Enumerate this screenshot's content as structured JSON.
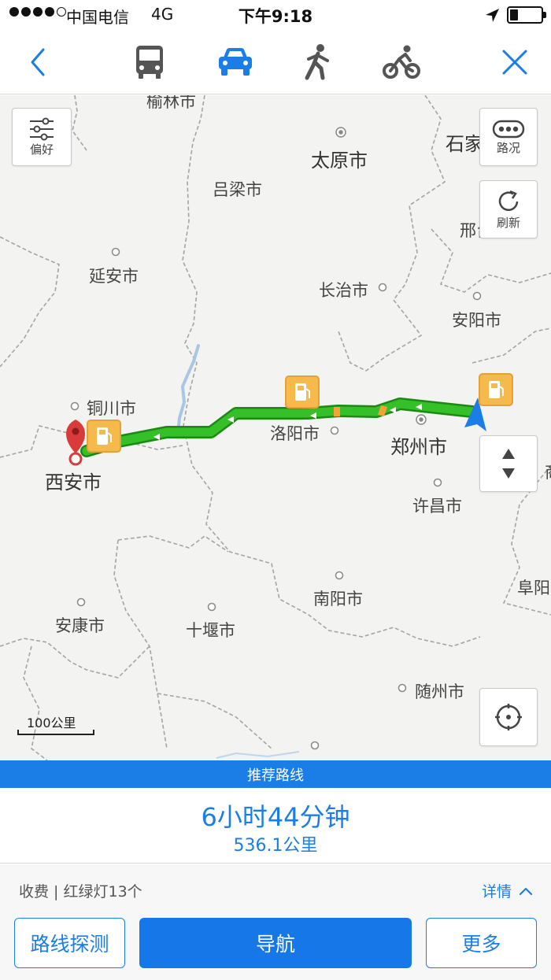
{
  "status_bar": {
    "carrier": "中国电信",
    "network": "4G",
    "time": "下午9:18"
  },
  "nav": {
    "modes": [
      {
        "name": "bus",
        "icon": "bus-icon",
        "selected": false
      },
      {
        "name": "car",
        "icon": "car-icon",
        "selected": true
      },
      {
        "name": "walk",
        "icon": "walk-icon",
        "selected": false
      },
      {
        "name": "bike",
        "icon": "bike-icon",
        "selected": false
      }
    ],
    "accent_color": "#1b7de6"
  },
  "map": {
    "controls": {
      "preference_label": "偏好",
      "traffic_label": "路况",
      "refresh_label": "刷新"
    },
    "cities": {
      "yulin": "榆林市",
      "taiyuan": "太原市",
      "shijiazhuang": "石家",
      "lvliang": "吕梁市",
      "xingtai": "邢台",
      "yanan": "延安市",
      "changzhi": "长治市",
      "anyang": "安阳市",
      "tongchuan": "铜川市",
      "luoyang": "洛阳市",
      "zhengzhou": "郑州市",
      "xian": "西安市",
      "xuchang": "许昌市",
      "nanyang": "南阳市",
      "fuyang": "阜阳",
      "ankang": "安康市",
      "shiyan": "十堰市",
      "suizhou": "随州市",
      "edge_right": "商"
    },
    "scale_label": "100公里",
    "route_color": "#2eae20"
  },
  "route": {
    "header": "推荐路线",
    "duration": "6小时44分钟",
    "distance": "536.1公里",
    "info": "收费 | 红绿灯13个",
    "details_label": "详情"
  },
  "actions": {
    "probe_label": "路线探测",
    "navigate_label": "导航",
    "more_label": "更多"
  }
}
